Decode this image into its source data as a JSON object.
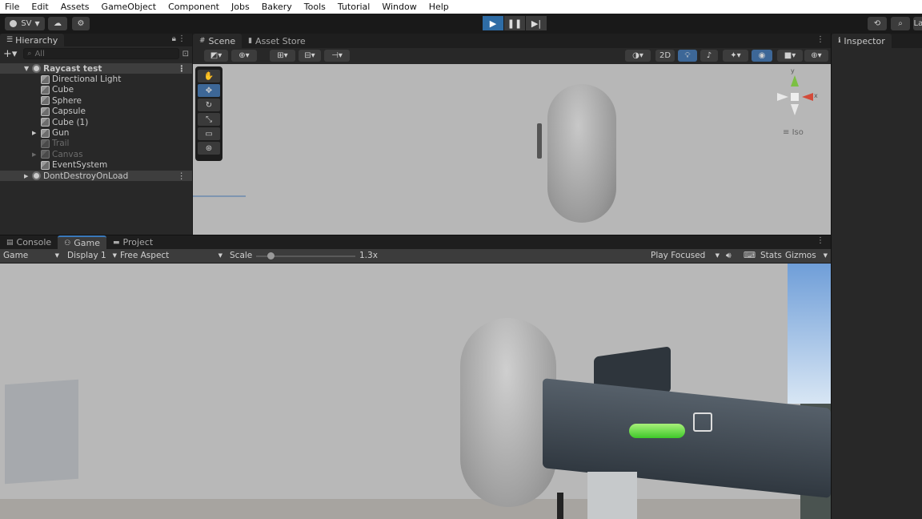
{
  "menu": [
    "File",
    "Edit",
    "Assets",
    "GameObject",
    "Component",
    "Jobs",
    "Bakery",
    "Tools",
    "Tutorial",
    "Window",
    "Help"
  ],
  "toolbar": {
    "account": "SV",
    "right_label": "La"
  },
  "hierarchy": {
    "tab": "Hierarchy",
    "search_placeholder": "All",
    "scene_root": "Raycast test",
    "items": [
      {
        "label": "Directional Light",
        "dim": false,
        "arrow": false
      },
      {
        "label": "Cube",
        "dim": false,
        "arrow": false
      },
      {
        "label": "Sphere",
        "dim": false,
        "arrow": false
      },
      {
        "label": "Capsule",
        "dim": false,
        "arrow": false
      },
      {
        "label": "Cube (1)",
        "dim": false,
        "arrow": false
      },
      {
        "label": "Gun",
        "dim": false,
        "arrow": true
      },
      {
        "label": "Trail",
        "dim": true,
        "arrow": false
      },
      {
        "label": "Canvas",
        "dim": true,
        "arrow": true
      },
      {
        "label": "EventSystem",
        "dim": false,
        "arrow": false
      }
    ],
    "dont_destroy": "DontDestroyOnLoad"
  },
  "scene": {
    "tabs": [
      "Scene",
      "Asset Store"
    ],
    "btn_2d": "2D",
    "iso_label": "Iso",
    "gizmo_x": "x",
    "gizmo_y": "y"
  },
  "inspector": {
    "tab": "Inspector"
  },
  "game": {
    "tabs": [
      "Console",
      "Game",
      "Project"
    ],
    "display_mode": "Game",
    "display": "Display 1",
    "aspect": "Free Aspect",
    "scale_label": "Scale",
    "scale_value": "1.3x",
    "play_mode": "Play Focused",
    "stats": "Stats",
    "gizmos": "Gizmos"
  }
}
